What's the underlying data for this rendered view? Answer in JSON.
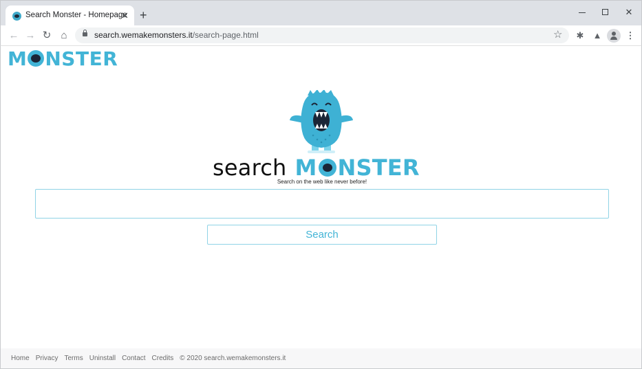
{
  "browser": {
    "tab_title": "Search Monster - Homepage",
    "tab_close": "✕",
    "new_tab": "+",
    "url_host": "search.wemakemonsters.it",
    "url_path": "/search-page.html",
    "icons": [
      "favicon-icon",
      "close-icon",
      "plus-icon",
      "back-icon",
      "forward-icon",
      "reload-icon",
      "home-icon",
      "lock-icon",
      "star-icon",
      "extensions-icon",
      "flask-icon",
      "profile-icon",
      "menu-icon"
    ]
  },
  "header": {
    "logo_part1": "M",
    "logo_part2": "NSTER"
  },
  "hero": {
    "word1": "search",
    "word2_part1": "M",
    "word2_part2": "NSTER",
    "tagline": "Search on the web like never before!"
  },
  "search": {
    "input_value": "",
    "input_placeholder": "",
    "button_label": "Search"
  },
  "footer": {
    "links": [
      "Home",
      "Privacy",
      "Terms",
      "Uninstall",
      "Contact",
      "Credits"
    ],
    "copyright": "© 2020 search.wemakemonsters.it"
  },
  "colors": {
    "brand_blue": "#42b4d6",
    "border_blue": "#8fd3e6",
    "monster_dark": "#1b2536"
  }
}
